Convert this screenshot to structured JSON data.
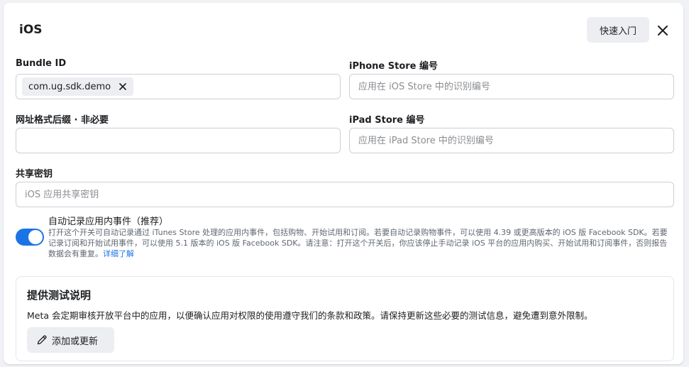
{
  "dialog": {
    "title": "iOS",
    "quick_start_label": "快速入门",
    "close_icon": "close-icon"
  },
  "form": {
    "bundle_id": {
      "label": "Bundle ID",
      "chip_value": "com.ug.sdk.demo"
    },
    "iphone_store": {
      "label": "iPhone Store 编号",
      "placeholder": "应用在 iOS Store 中的识别编号"
    },
    "url_suffix": {
      "label": "网址格式后缀 · 非必要",
      "placeholder": ""
    },
    "ipad_store": {
      "label": "iPad Store 编号",
      "placeholder": "应用在 iPad Store 中的识别编号"
    },
    "shared_secret": {
      "label": "共享密钥",
      "placeholder": "iOS 应用共享密钥"
    }
  },
  "auto_log": {
    "enabled": true,
    "title": "自动记录应用内事件（推荐）",
    "description": "打开这个开关可自动记录通过 iTunes Store 处理的应用内事件，包括购物、开始试用和订阅。若要自动记录购物事件，可以使用 4.39 或更高版本的 iOS 版 Facebook SDK。若要记录订阅和开始试用事件，可以使用 5.1 版本的 iOS 版 Facebook SDK。请注意：打开这个开关后，你应该停止手动记录 iOS 平台的应用内购买、开始试用和订阅事件，否则报告数据会有重复。",
    "learn_more": "详细了解"
  },
  "testing": {
    "title": "提供测试说明",
    "description": "Meta 会定期审核开放平台中的应用，以便确认应用对权限的使用遵守我们的条款和政策。请保持更新这些必要的测试信息，避免遭到意外限制。",
    "add_button_label": "添加或更新",
    "add_icon": "pencil-icon"
  },
  "colors": {
    "accent": "#1b74e4",
    "button_bg": "#eceef1",
    "border": "#ccd0d5"
  }
}
